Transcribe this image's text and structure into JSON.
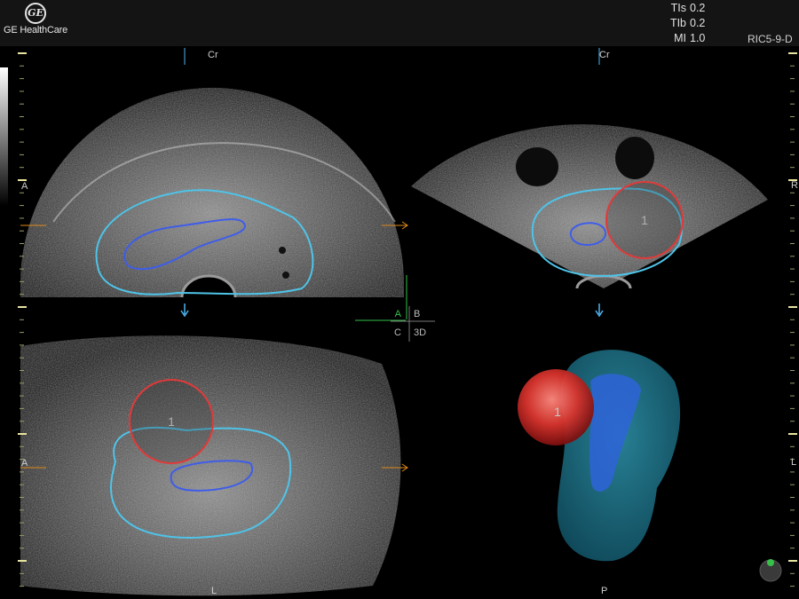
{
  "brand": {
    "logo_text": "GE",
    "name": "GE HealthCare"
  },
  "params": [
    {
      "label": "TIs",
      "value": "0.2"
    },
    {
      "label": "TIb",
      "value": "0.2"
    },
    {
      "label": "MI",
      "value": "1.0"
    }
  ],
  "probe": "RIC5-9-D",
  "orientation": {
    "view_a_top": "Cr",
    "view_a_left": "A",
    "view_b_top": "Cr",
    "view_b_right": "R",
    "view_c_left": "A",
    "view_c_bottom": "L",
    "view_d_right": "L",
    "view_d_bottom": "P"
  },
  "quad_selector": {
    "a": "A",
    "b": "B",
    "c": "C",
    "d": "3D"
  },
  "lesion_label": "1",
  "colors": {
    "prostate_outline": "#4fc3e8",
    "urethra_outline": "#3f5de8",
    "lesion_outline": "#e03a3a",
    "orientation_arrow": "#e08a1a",
    "scan_marker": "#4fb4f0"
  }
}
